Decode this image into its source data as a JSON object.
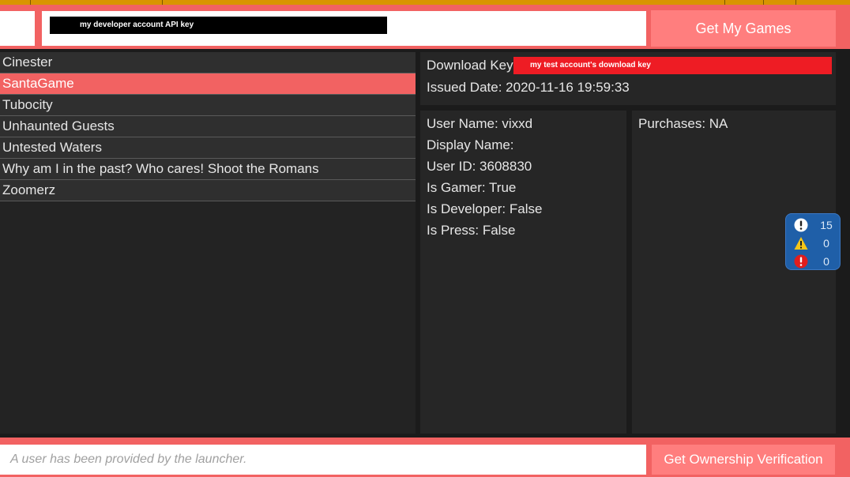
{
  "header": {
    "api_key_value": "my developer account API key",
    "get_games_label": "Get My Games"
  },
  "games": [
    {
      "title": "Cinester",
      "selected": false
    },
    {
      "title": "SantaGame",
      "selected": true
    },
    {
      "title": "Tubocity",
      "selected": false
    },
    {
      "title": "Unhaunted Guests",
      "selected": false
    },
    {
      "title": "Untested Waters",
      "selected": false
    },
    {
      "title": "Why am I in the past? Who cares! Shoot the Romans",
      "selected": false
    },
    {
      "title": "Zoomerz",
      "selected": false
    }
  ],
  "key_panel": {
    "download_key_label": "Download Key:",
    "download_key_value": "my test account's download key",
    "issued_date_text": "Issued Date: 2020-11-16 19:59:33"
  },
  "user": {
    "lines": [
      "User Name: vixxd",
      "Display Name:",
      "User ID: 3608830",
      "Is Gamer: True",
      "Is Developer: False",
      "Is Press: False"
    ]
  },
  "purchases": {
    "text": "Purchases: NA"
  },
  "diagnostics": {
    "info_count": "15",
    "warning_count": "0",
    "error_count": "0",
    "info_icon": "info-icon",
    "warning_icon": "warning-icon",
    "error_icon": "error-icon"
  },
  "footer": {
    "status_text": "A user has been provided by the launcher.",
    "verify_label": "Get Ownership Verification"
  },
  "colors": {
    "accent": "#f26262",
    "button": "#ff7e7e",
    "top_strip": "#d99400",
    "panel": "#262626",
    "background": "#1b1b1b",
    "diagnostics_bg": "#1f5fa8",
    "redact_download_key": "#ee1c24"
  }
}
